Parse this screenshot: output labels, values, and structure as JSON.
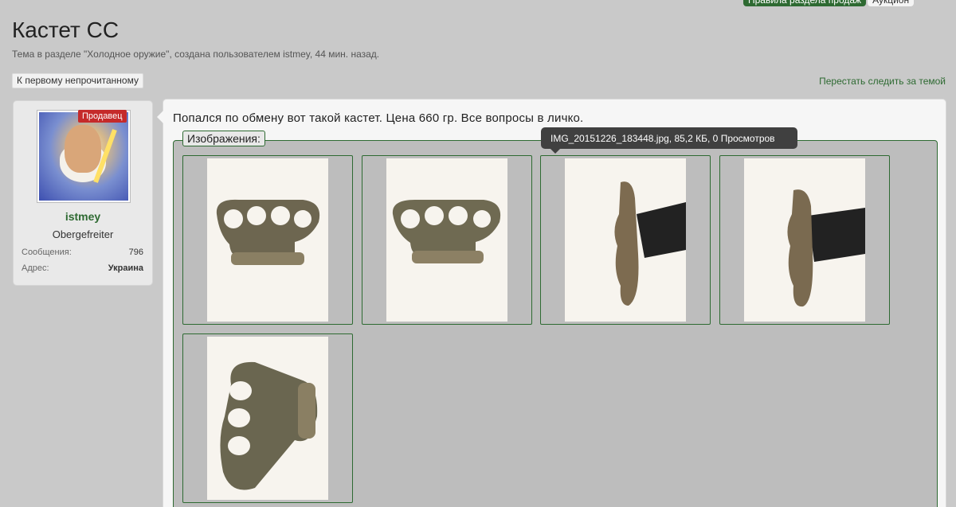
{
  "top_tabs": {
    "rules": "Правила раздела продаж",
    "auction": "Аукцион"
  },
  "thread": {
    "title": "Кастет СС",
    "description": "Тема в разделе \"Холодное оружие\", создана пользователем istmey, 44 мин. назад.",
    "unread_button": "К первому непрочитанному",
    "unwatch_link": "Перестать следить за темой"
  },
  "user": {
    "badge": "Продавец",
    "name": "istmey",
    "rank": "Obergefreiter",
    "stats": [
      {
        "key": "Сообщения:",
        "value": "796"
      },
      {
        "key": "Адрес:",
        "value": "Украина"
      }
    ]
  },
  "post": {
    "text": "Попался по обмену вот такой кастет. Цена 660 гр. Все вопросы в личко.",
    "attachments_label": "Изображения:",
    "tooltip": "IMG_20151226_183448.jpg, 85,2 КБ, 0 Просмотров"
  },
  "colors": {
    "accent": "#2e6a32",
    "badge": "#c52a2a",
    "background": "#c9c9c9"
  }
}
